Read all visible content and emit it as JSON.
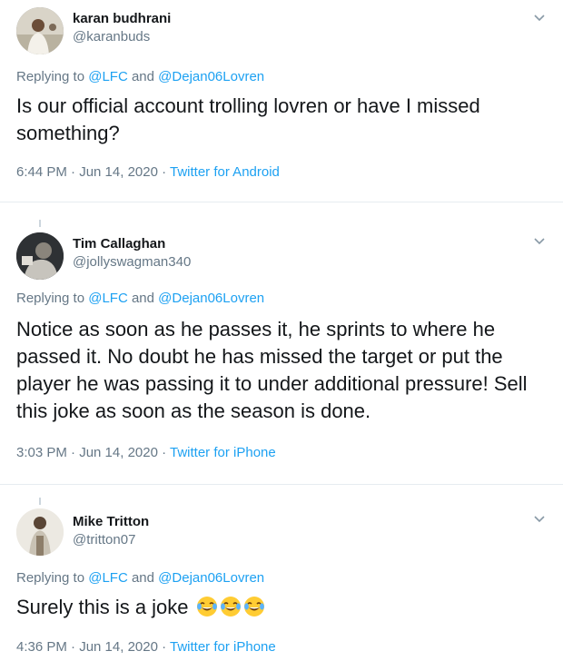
{
  "tweets": [
    {
      "name": "karan budhrani",
      "handle": "@karanbuds",
      "replying_prefix": "Replying to",
      "reply_to_1": "@LFC",
      "reply_and": "and",
      "reply_to_2": "@Dejan06Lovren",
      "text": "Is our official account trolling lovren or have I missed something?",
      "time": "6:44 PM · Jun 14, 2020 · ",
      "source": "Twitter for Android",
      "avatar_icon": "person-avatar"
    },
    {
      "name": "Tim Callaghan",
      "handle": "@jollyswagman340",
      "replying_prefix": "Replying to",
      "reply_to_1": "@LFC",
      "reply_and": "and",
      "reply_to_2": "@Dejan06Lovren",
      "text": "Notice as soon as he passes it, he sprints to where he passed it. No doubt he has missed the target or put the player he was passing it to under additional pressure! Sell this joke as soon as the season is done.",
      "time": "3:03 PM · Jun 14, 2020 · ",
      "source": "Twitter for iPhone",
      "avatar_icon": "person-avatar"
    },
    {
      "name": "Mike Tritton",
      "handle": "@tritton07",
      "replying_prefix": "Replying to",
      "reply_to_1": "@LFC",
      "reply_and": "and",
      "reply_to_2": "@Dejan06Lovren",
      "text": "Surely this is a joke",
      "emojis": [
        "face-with-tears-of-joy",
        "face-with-tears-of-joy",
        "face-with-tears-of-joy"
      ],
      "time": "4:36 PM · Jun 14, 2020 · ",
      "source": "Twitter for iPhone",
      "avatar_icon": "person-avatar"
    }
  ],
  "colors": {
    "link": "#1da1f2",
    "muted": "#657786",
    "text": "#14171a",
    "separator": "#e6ecf0"
  },
  "icons": {
    "caret": "chevron-down-icon"
  }
}
